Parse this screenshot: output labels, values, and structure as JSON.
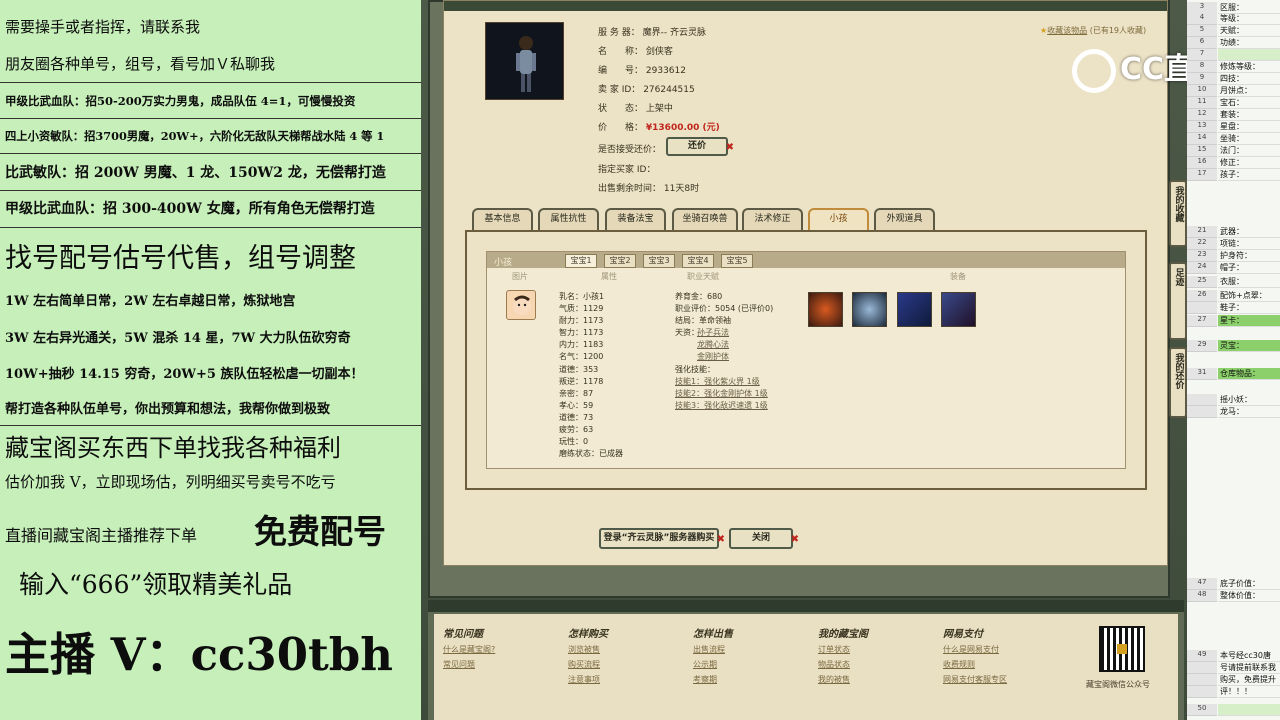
{
  "overlay": {
    "lines": [
      "需要操手或者指挥，请联系我",
      "朋友圈各种单号，组号，看号加Ｖ私聊我",
      "甲级比武血队：招50-200万实力男鬼，成品队伍 4=1，可慢慢投资",
      "四上小资敏队：招3700男魔，20W+，六阶化无敌队天梯帮战水陆 4 等 1",
      "比武敏队：招 200W 男魔、1 龙、150W2 龙，无偿帮打造",
      "甲级比武血队：招 300-400W 女魔，所有角色无偿帮打造",
      "找号配号估号代售，组号调整",
      "1W 左右简单日常，2W 左右卓越日常，炼狱地宫",
      "3W 左右异光通关，5W 混杀 14 星，7W 大力队伍砍穷奇",
      "10W+抽秒 14.15 穷奇，20W+5 族队伍轻松虐一切副本！",
      "帮打造各种队伍单号，你出预算和想法，我帮你做到极致",
      "藏宝阁买东西下单找我各种福利",
      "估价加我 V，立即现场估，列明细买号卖号不吃亏",
      "直播间藏宝阁主播推荐下单",
      "免费配号",
      "输入“666”领取精美礼品",
      "主播 V：cc30tbh"
    ]
  },
  "item": {
    "server_label": "服 务 器：",
    "server": "魔界-- 齐云灵脉",
    "name_label": "名　　称：",
    "name": "剑侠客",
    "id_label": "编　　号：",
    "id": "2933612",
    "seller_label": "卖 家 ID：",
    "seller": "276244515",
    "status_label": "状　　态：",
    "status": "上架中",
    "price_label": "价　　格：",
    "price": "¥13600.00 (元)",
    "bargain_label": "是否接受还价：",
    "bargain_button": "还价",
    "buyer_label": "指定买家 ID：",
    "buyer": "",
    "remain_label": "出售剩余时间：",
    "remain": "11天8时",
    "favorite": "收藏该物品",
    "favorite_count": "(已有19人收藏)"
  },
  "tabs": [
    "基本信息",
    "属性抗性",
    "装备法宝",
    "坐骑召唤兽",
    "法术修正",
    "小孩",
    "外观道具"
  ],
  "child": {
    "header": "小孩",
    "sub_tabs": [
      "宝宝1",
      "宝宝2",
      "宝宝3",
      "宝宝4",
      "宝宝5"
    ],
    "columns": [
      "图片",
      "属性",
      "职业天赋",
      "装备"
    ],
    "stats": [
      "乳名：小孩1",
      "气质：1129",
      "耐力：1173",
      "智力：1173",
      "内力：1183",
      "名气：1200",
      "道德：353",
      "叛逆：1178",
      "亲密：87",
      "孝心：59",
      "道德：73",
      "疲劳：63",
      "玩性：0",
      "磨练状态：已成器"
    ],
    "talent": [
      "养育金：680",
      "职业评价：5054 (已评价0)",
      "结局：革命领袖",
      "天资：",
      "孙子兵法",
      "龙腾心法",
      "金刚护体",
      "强化技能：",
      "技能1：强化紫火界 1级",
      "技能2：强化金刚护体 1级",
      "技能3：强化敌迟速遗 1级"
    ],
    "equip_icons": [
      "equip-red-icon",
      "equip-robe-icon",
      "equip-book-icon",
      "equip-box-icon"
    ]
  },
  "actions": {
    "buy": "登录“齐云灵脉”服务器购买",
    "close": "关闭"
  },
  "side_tabs": [
    "我的收藏",
    "足迹",
    "我的还价"
  ],
  "logo": "CC直播",
  "footer": {
    "sections": [
      {
        "title": "常见问题",
        "links": [
          "什么是藏宝阁?",
          "常见问题"
        ]
      },
      {
        "title": "怎样购买",
        "links": [
          "浏览被售",
          "购买流程",
          "注意事项"
        ]
      },
      {
        "title": "怎样出售",
        "links": [
          "出售流程",
          "公示期",
          "考察期"
        ]
      },
      {
        "title": "我的藏宝阁",
        "links": [
          "订单状态",
          "物品状态",
          "我的被售"
        ]
      },
      {
        "title": "网易支付",
        "links": [
          "什么是网易支付",
          "收费规则",
          "网易支付客服专区"
        ]
      }
    ],
    "qr_caption": "藏宝阁微信公众号"
  },
  "sheet": {
    "rows": [
      {
        "n": "3",
        "t": "区服："
      },
      {
        "n": "4",
        "t": "等级："
      },
      {
        "n": "5",
        "t": "天赋："
      },
      {
        "n": "6",
        "t": "功绩："
      },
      {
        "n": "7",
        "t": ""
      },
      {
        "n": "8",
        "t": "修炼等级："
      },
      {
        "n": "9",
        "t": "四技："
      },
      {
        "n": "10",
        "t": "月饼点："
      },
      {
        "n": "11",
        "t": "宝石："
      },
      {
        "n": "12",
        "t": "套装："
      },
      {
        "n": "13",
        "t": "星盘："
      },
      {
        "n": "14",
        "t": "坐骑："
      },
      {
        "n": "15",
        "t": "法门："
      },
      {
        "n": "16",
        "t": "修正："
      },
      {
        "n": "17",
        "t": "孩子："
      },
      {
        "n": "21",
        "t": "武器："
      },
      {
        "n": "22",
        "t": "项链："
      },
      {
        "n": "23",
        "t": "护身符："
      },
      {
        "n": "24",
        "t": "帽子："
      },
      {
        "n": "25",
        "t": "衣服："
      },
      {
        "n": "26",
        "t": "配饰+点翠："
      },
      {
        "n": "",
        "t": "鞋子："
      },
      {
        "n": "27",
        "t": "星卡："
      },
      {
        "n": "29",
        "t": "灵宝："
      },
      {
        "n": "31",
        "t": "仓库物品："
      },
      {
        "n": "",
        "t": "摇小妖："
      },
      {
        "n": "",
        "t": "龙马："
      },
      {
        "n": "47",
        "t": "底子价值："
      },
      {
        "n": "48",
        "t": "整体价值："
      },
      {
        "n": "49",
        "t": "本号经cc30唐"
      },
      {
        "n": "",
        "t": "号请提前联系我"
      },
      {
        "n": "",
        "t": "购买，免费提升"
      },
      {
        "n": "",
        "t": "评！！！"
      },
      {
        "n": "50",
        "t": ""
      }
    ]
  }
}
